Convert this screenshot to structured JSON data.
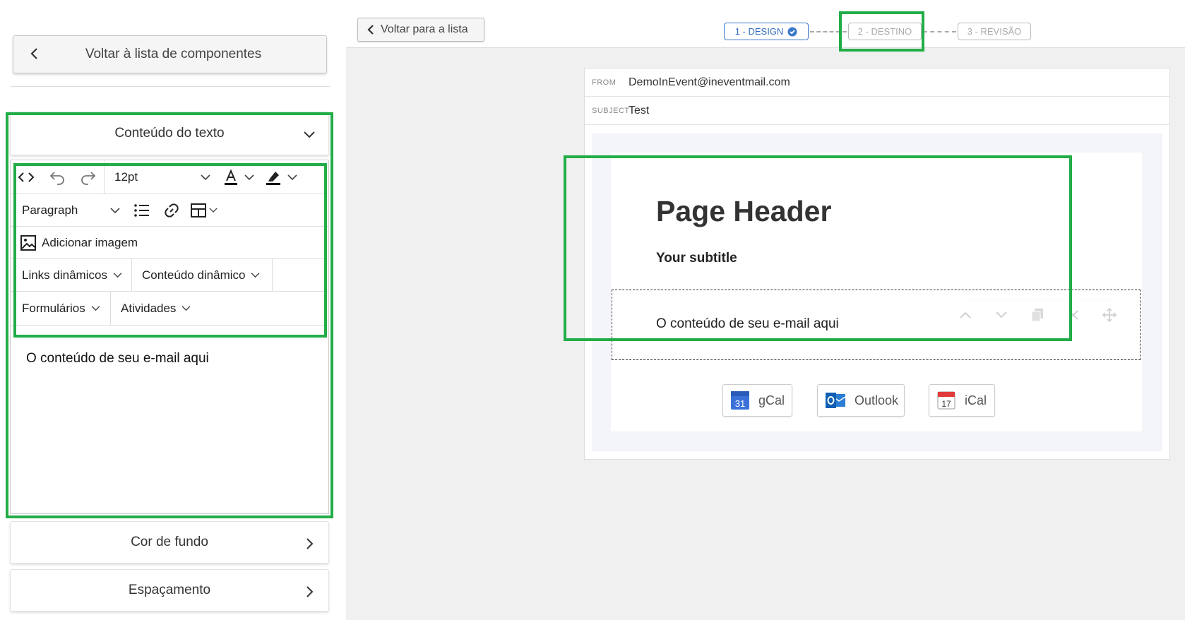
{
  "left_panel": {
    "back_button_label": "Voltar à lista de componentes",
    "text_section": {
      "title": "Conteúdo do texto",
      "toolbar": {
        "font_size": "12pt",
        "block_format": "Paragraph",
        "add_image_label": "Adicionar imagem",
        "dynamic_links_label": "Links dinâmicos",
        "dynamic_content_label": "Conteúdo dinâmico",
        "forms_label": "Formulários",
        "activities_label": "Atividades"
      },
      "body_text": "O conteúdo de seu e-mail aqui"
    },
    "background_section_title": "Cor de fundo",
    "spacing_section_title": "Espaçamento"
  },
  "topbar": {
    "back_to_list_label": "Voltar para a lista",
    "steps": [
      {
        "label": "1 - DESIGN",
        "state": "done"
      },
      {
        "label": "2 - DESTINO",
        "state": "pending"
      },
      {
        "label": "3 - REVISÃO",
        "state": "pending"
      }
    ]
  },
  "email_preview": {
    "from_key": "FROM",
    "from_value": "DemoInEvent@ineventmail.com",
    "subject_key": "SUBJECT",
    "subject_value": "Test",
    "page_header": "Page Header",
    "subtitle": "Your subtitle",
    "content_text": "O conteúdo de seu e-mail aqui",
    "calendar_buttons": [
      {
        "label": "gCal",
        "icon": "google-calendar-icon"
      },
      {
        "label": "Outlook",
        "icon": "outlook-icon"
      },
      {
        "label": "iCal",
        "icon": "ical-icon"
      }
    ],
    "gcal_day": "31",
    "ical_day": "17"
  },
  "colors": {
    "highlight": "#22ad48",
    "step_active": "#3a78c9"
  }
}
